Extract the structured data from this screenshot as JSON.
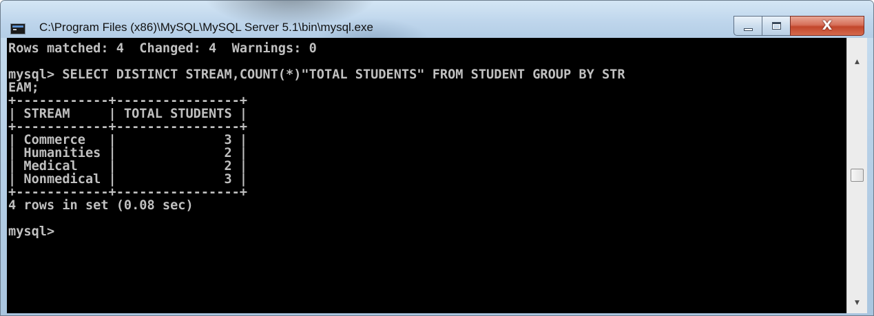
{
  "window": {
    "title": "C:\\Program Files (x86)\\MySQL\\MySQL Server 5.1\\bin\\mysql.exe",
    "icon": "console-app-icon",
    "controls": {
      "minimize_icon": "minimize-icon",
      "maximize_icon": "maximize-icon",
      "close_label": "X"
    }
  },
  "console": {
    "lines": [
      "Rows matched: 4  Changed: 4  Warnings: 0",
      "",
      "mysql> SELECT DISTINCT STREAM,COUNT(*)\"TOTAL STUDENTS\" FROM STUDENT GROUP BY STR",
      "EAM;",
      "+------------+----------------+",
      "| STREAM     | TOTAL STUDENTS |",
      "+------------+----------------+",
      "| Commerce   |              3 |",
      "| Humanities |              2 |",
      "| Medical    |              2 |",
      "| Nonmedical |              3 |",
      "+------------+----------------+",
      "4 rows in set (0.08 sec)",
      "",
      "mysql>"
    ],
    "query_result": {
      "columns": [
        "STREAM",
        "TOTAL STUDENTS"
      ],
      "rows": [
        [
          "Commerce",
          "3"
        ],
        [
          "Humanities",
          "2"
        ],
        [
          "Medical",
          "2"
        ],
        [
          "Nonmedical",
          "3"
        ]
      ]
    },
    "colors": {
      "background": "#000000",
      "text": "#c0c0c0"
    }
  },
  "scrollbar": {
    "up_icon": "scroll-up-arrow-icon",
    "down_icon": "scroll-down-arrow-icon"
  }
}
